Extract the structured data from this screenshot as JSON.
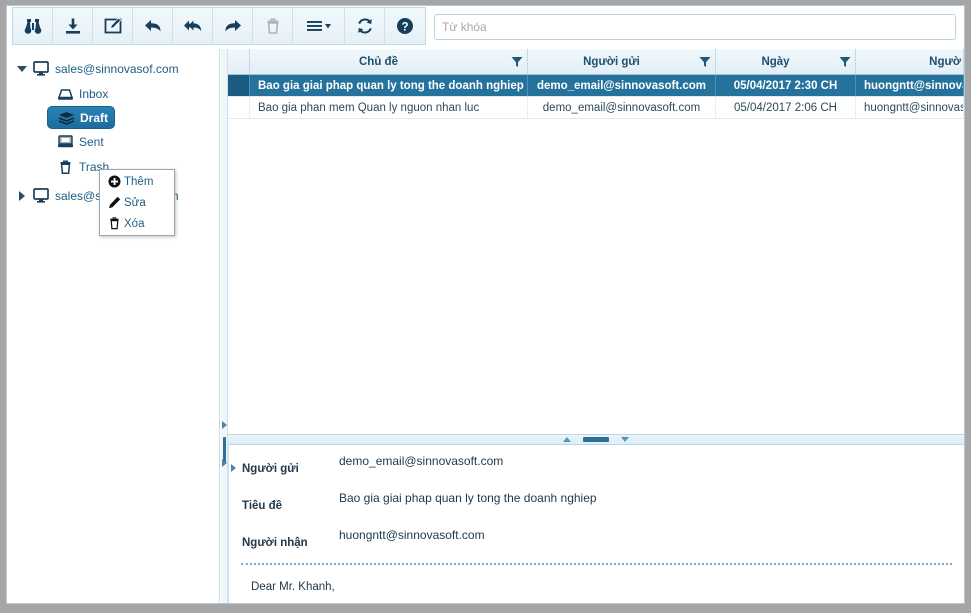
{
  "toolbar": {
    "buttons": [
      {
        "name": "find-button",
        "icon": "binoculars-icon",
        "label": "Tìm kiếm",
        "disabled": false
      },
      {
        "name": "download-button",
        "icon": "download-icon",
        "label": "Tải về",
        "disabled": false
      },
      {
        "name": "compose-button",
        "icon": "compose-icon",
        "label": "Soạn thư",
        "disabled": false
      },
      {
        "name": "reply-button",
        "icon": "reply-icon",
        "label": "Trả lời",
        "disabled": false
      },
      {
        "name": "reply-all-button",
        "icon": "reply-all-icon",
        "label": "Trả lời tất cả",
        "disabled": false
      },
      {
        "name": "forward-button",
        "icon": "forward-icon",
        "label": "Chuyển tiếp",
        "disabled": false
      },
      {
        "name": "delete-button",
        "icon": "trash-icon",
        "label": "Xóa",
        "disabled": true
      },
      {
        "name": "more-menu-button",
        "icon": "hamburger-dropdown-icon",
        "label": "Thêm lựa chọn",
        "disabled": false
      },
      {
        "name": "refresh-button",
        "icon": "refresh-icon",
        "label": "Làm mới",
        "disabled": false
      },
      {
        "name": "help-button",
        "icon": "help-icon",
        "label": "Trợ giúp",
        "disabled": false
      }
    ],
    "search": {
      "value": "",
      "placeholder": "Từ khóa"
    }
  },
  "sidebar": {
    "accounts": [
      {
        "label": "sales@sinnovasof.com",
        "icon": "monitor-icon",
        "expanded": true,
        "folders": [
          {
            "label": "Inbox",
            "icon": "inbox-icon",
            "selected": false
          },
          {
            "label": "Draft",
            "icon": "layers-icon",
            "selected": true
          },
          {
            "label": "Sent",
            "icon": "sent-tray-icon",
            "selected": false
          },
          {
            "label": "Trash",
            "icon": "trash-icon",
            "selected": false
          }
        ]
      },
      {
        "label": "sales@sinnovasof.com",
        "icon": "monitor-icon",
        "expanded": false,
        "folders": []
      }
    ]
  },
  "context_menu": {
    "items": [
      {
        "label": "Thêm",
        "icon": "plus-circle-icon"
      },
      {
        "label": "Sửa",
        "icon": "pencil-icon"
      },
      {
        "label": "Xóa",
        "icon": "trash-icon"
      }
    ]
  },
  "grid": {
    "columns": [
      {
        "label": "Chủ đề",
        "filter": true
      },
      {
        "label": "Người gửi",
        "filter": true
      },
      {
        "label": "Ngày",
        "filter": true
      },
      {
        "label": "Ngườ",
        "filter": false
      }
    ],
    "rows": [
      {
        "subject": "Bao gia giai phap quan ly tong the doanh nghiep",
        "sender": "demo_email@sinnovasoft.com",
        "date": "05/04/2017 2:30 CH",
        "recipient": "huongntt@sinnovasoft.com",
        "selected": true
      },
      {
        "subject": "Bao gia phan mem Quan ly nguon nhan luc",
        "sender": "demo_email@sinnovasoft.com",
        "date": "05/04/2017 2:06 CH",
        "recipient": "huongntt@sinnovasoft.com",
        "selected": false
      }
    ]
  },
  "detail": {
    "fields": [
      {
        "label": "Người gửi",
        "value": "demo_email@sinnovasoft.com"
      },
      {
        "label": "Tiêu đề",
        "value": "Bao gia giai phap quan ly tong the doanh nghiep"
      },
      {
        "label": "Người nhận",
        "value": "huongntt@sinnovasoft.com"
      }
    ],
    "body": "Dear Mr. Khanh,"
  },
  "colors": {
    "accent": "#1f5d86",
    "selection": "#25739c",
    "header_bg": "#e8f2f8",
    "border": "#c3d9e6",
    "icon_dark": "#173f5b"
  }
}
